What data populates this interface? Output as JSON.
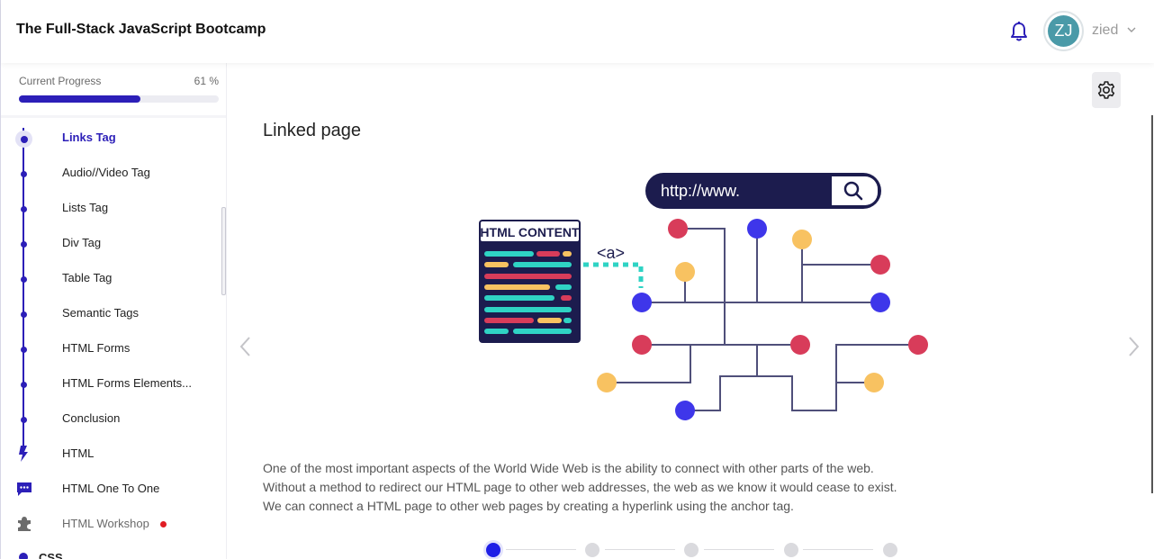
{
  "header": {
    "title": "The Full-Stack JavaScript Bootcamp",
    "user": {
      "initials": "ZJ",
      "name": "zied"
    }
  },
  "sidebar": {
    "progress": {
      "label": "Current Progress",
      "percent_text": "61 %",
      "value": 0.61
    },
    "items": [
      {
        "label": "Links Tag",
        "active": true
      },
      {
        "label": "Audio//Video Tag"
      },
      {
        "label": "Lists Tag"
      },
      {
        "label": "Div Tag"
      },
      {
        "label": "Table Tag"
      },
      {
        "label": "Semantic Tags"
      },
      {
        "label": "HTML Forms"
      },
      {
        "label": "HTML Forms Elements..."
      },
      {
        "label": "Conclusion"
      }
    ],
    "sections": [
      {
        "label": "HTML",
        "icon": "lightning-icon"
      },
      {
        "label": "HTML One To One",
        "icon": "chat-icon"
      },
      {
        "label": "HTML Workshop",
        "icon": "puzzle-icon",
        "notification": true
      },
      {
        "label": "CSS"
      }
    ]
  },
  "lesson": {
    "title": "Linked page",
    "illustration": {
      "url_text": "http://www.",
      "panel_title": "HTML CONTENT",
      "tag_text": "<a>"
    },
    "paragraphs": [
      "One of the most important aspects of the World Wide Web is the ability to connect with other parts of the web.",
      "Without a method to redirect our HTML page to other web addresses, the web as we know it would cease to exist.",
      "We can connect a HTML page to other web pages by creating a hyperlink using the anchor tag."
    ],
    "steps": {
      "total": 5,
      "current": 1
    }
  },
  "colors": {
    "accent": "#2c1fb8",
    "avatar": "#4a9aa8",
    "notification": "#e01c24",
    "step_current": "#1e1ee6"
  }
}
